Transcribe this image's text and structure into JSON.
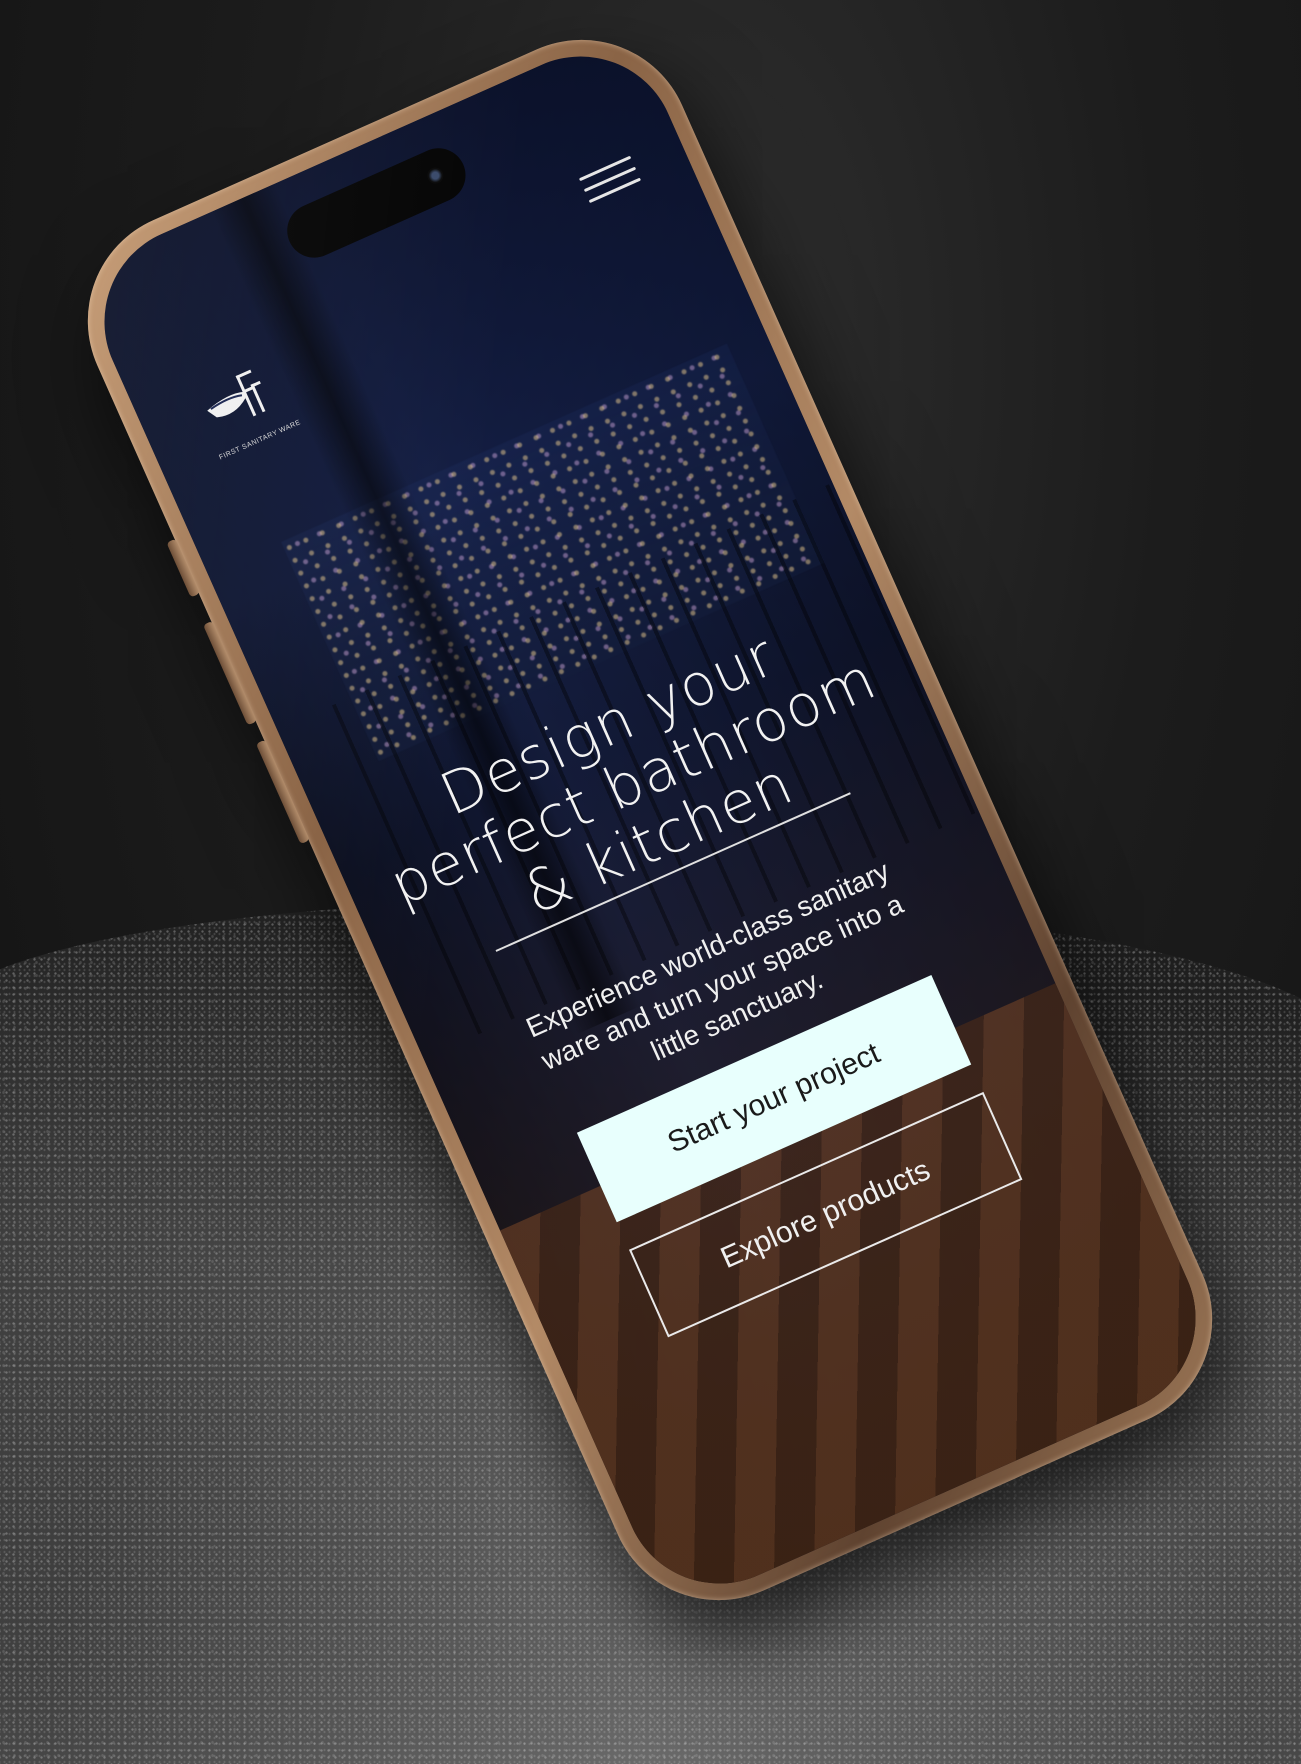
{
  "header": {
    "logo_caption": "FIRST SANITARY WARE",
    "menu_icon": "hamburger-menu-icon"
  },
  "hero": {
    "title_line1": "Design your",
    "title_line2": "perfect bathroom",
    "title_line3": "& kitchen",
    "subtitle": "Experience world-class sanitary ware and turn your space into a little sanctuary."
  },
  "actions": {
    "primary_label": "Start your project",
    "secondary_label": "Explore products"
  },
  "colors": {
    "primary_button_bg": "#e8fffd",
    "text_light": "#f2f2f2",
    "phone_frame": "#b38a66"
  }
}
